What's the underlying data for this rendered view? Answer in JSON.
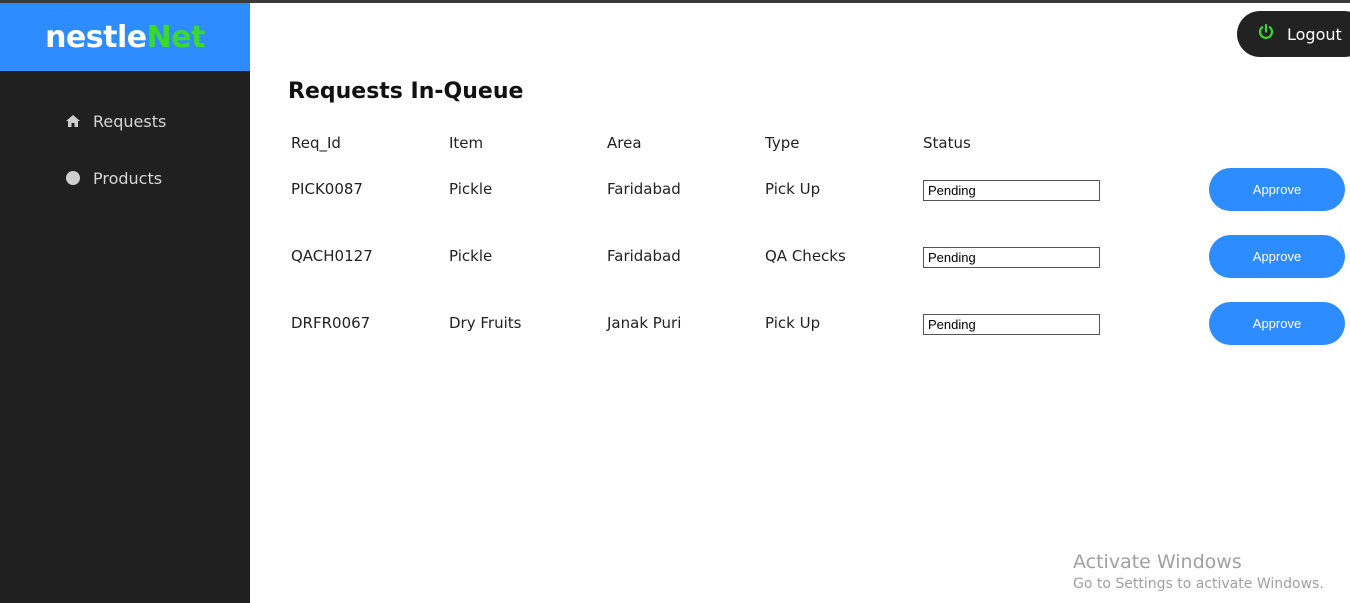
{
  "brand": {
    "part1": "nestle",
    "part2": "Net",
    "accent_color": "#39d92f",
    "header_color": "#2d8cff"
  },
  "sidebar": {
    "items": [
      {
        "label": "Requests",
        "icon": "home-icon"
      },
      {
        "label": "Products",
        "icon": "circle-icon"
      }
    ]
  },
  "header": {
    "logout_label": "Logout",
    "logout_icon": "power-icon"
  },
  "main": {
    "title": "Requests In-Queue",
    "columns": [
      "Req_Id",
      "Item",
      "Area",
      "Type",
      "Status"
    ],
    "rows": [
      {
        "req_id": "PICK0087",
        "item": "Pickle",
        "area": "Faridabad",
        "type": "Pick Up",
        "status": "Pending",
        "action": "Approve"
      },
      {
        "req_id": "QACH0127",
        "item": "Pickle",
        "area": "Faridabad",
        "type": "QA Checks",
        "status": "Pending",
        "action": "Approve"
      },
      {
        "req_id": "DRFR0067",
        "item": "Dry Fruits",
        "area": "Janak Puri",
        "type": "Pick Up",
        "status": "Pending",
        "action": "Approve"
      }
    ]
  },
  "watermark": {
    "line1": "Activate Windows",
    "line2": "Go to Settings to activate Windows."
  }
}
